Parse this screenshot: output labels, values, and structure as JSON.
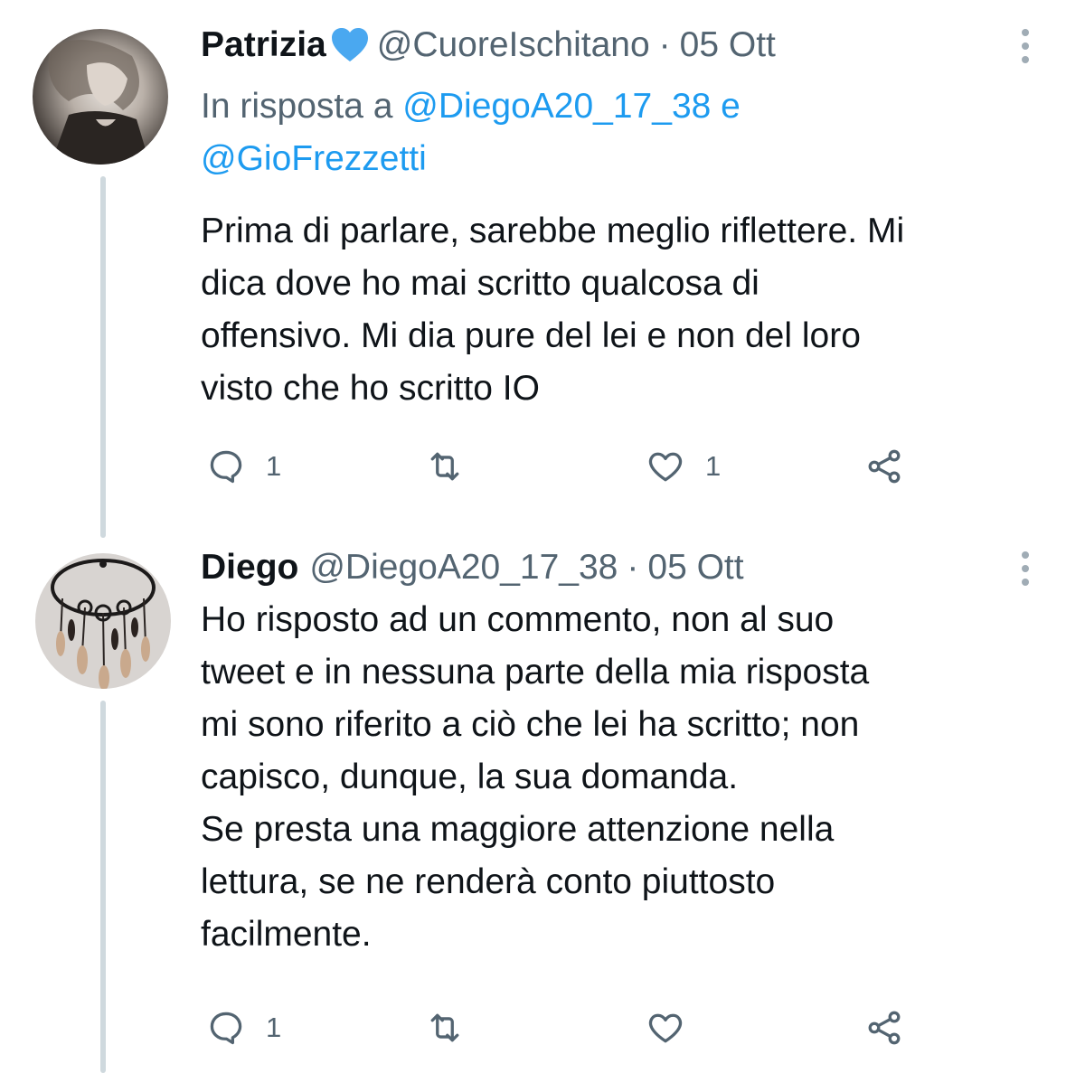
{
  "tweets": [
    {
      "name": "Patrizia",
      "badge": "blue-heart-icon",
      "handle": "@CuoreIschitano",
      "separator": "·",
      "date": "05 Ott",
      "reply_prefix": "In risposta a",
      "reply_users": [
        "@DiegoA20_17_38",
        "@GioFrezzetti"
      ],
      "reply_joiner": "e",
      "text": "Prima di parlare, sarebbe meglio riflettere. Mi\ndica dove ho mai scritto qualcosa di\noffensivo. Mi dia pure del lei e non del loro\nvisto che ho scritto IO",
      "replies": "1",
      "retweets": "",
      "likes": "1"
    },
    {
      "name": "Diego",
      "handle": "@DiegoA20_17_38",
      "separator": "·",
      "date": "05 Ott",
      "text": "Ho risposto ad un commento, non al suo\ntweet e in nessuna parte della mia risposta\nmi sono riferito a ciò che lei ha scritto; non\ncapisco, dunque, la sua domanda.\nSe presta una maggiore attenzione nella\nlettura, se ne renderà conto piuttosto\nfacilmente.",
      "replies": "1",
      "retweets": "",
      "likes": ""
    }
  ],
  "colors": {
    "text": "#0f1419",
    "secondary": "#536471",
    "link": "#1d9bf0",
    "heart_badge": "#4aa8f0",
    "thread_line": "#cfd9de"
  }
}
